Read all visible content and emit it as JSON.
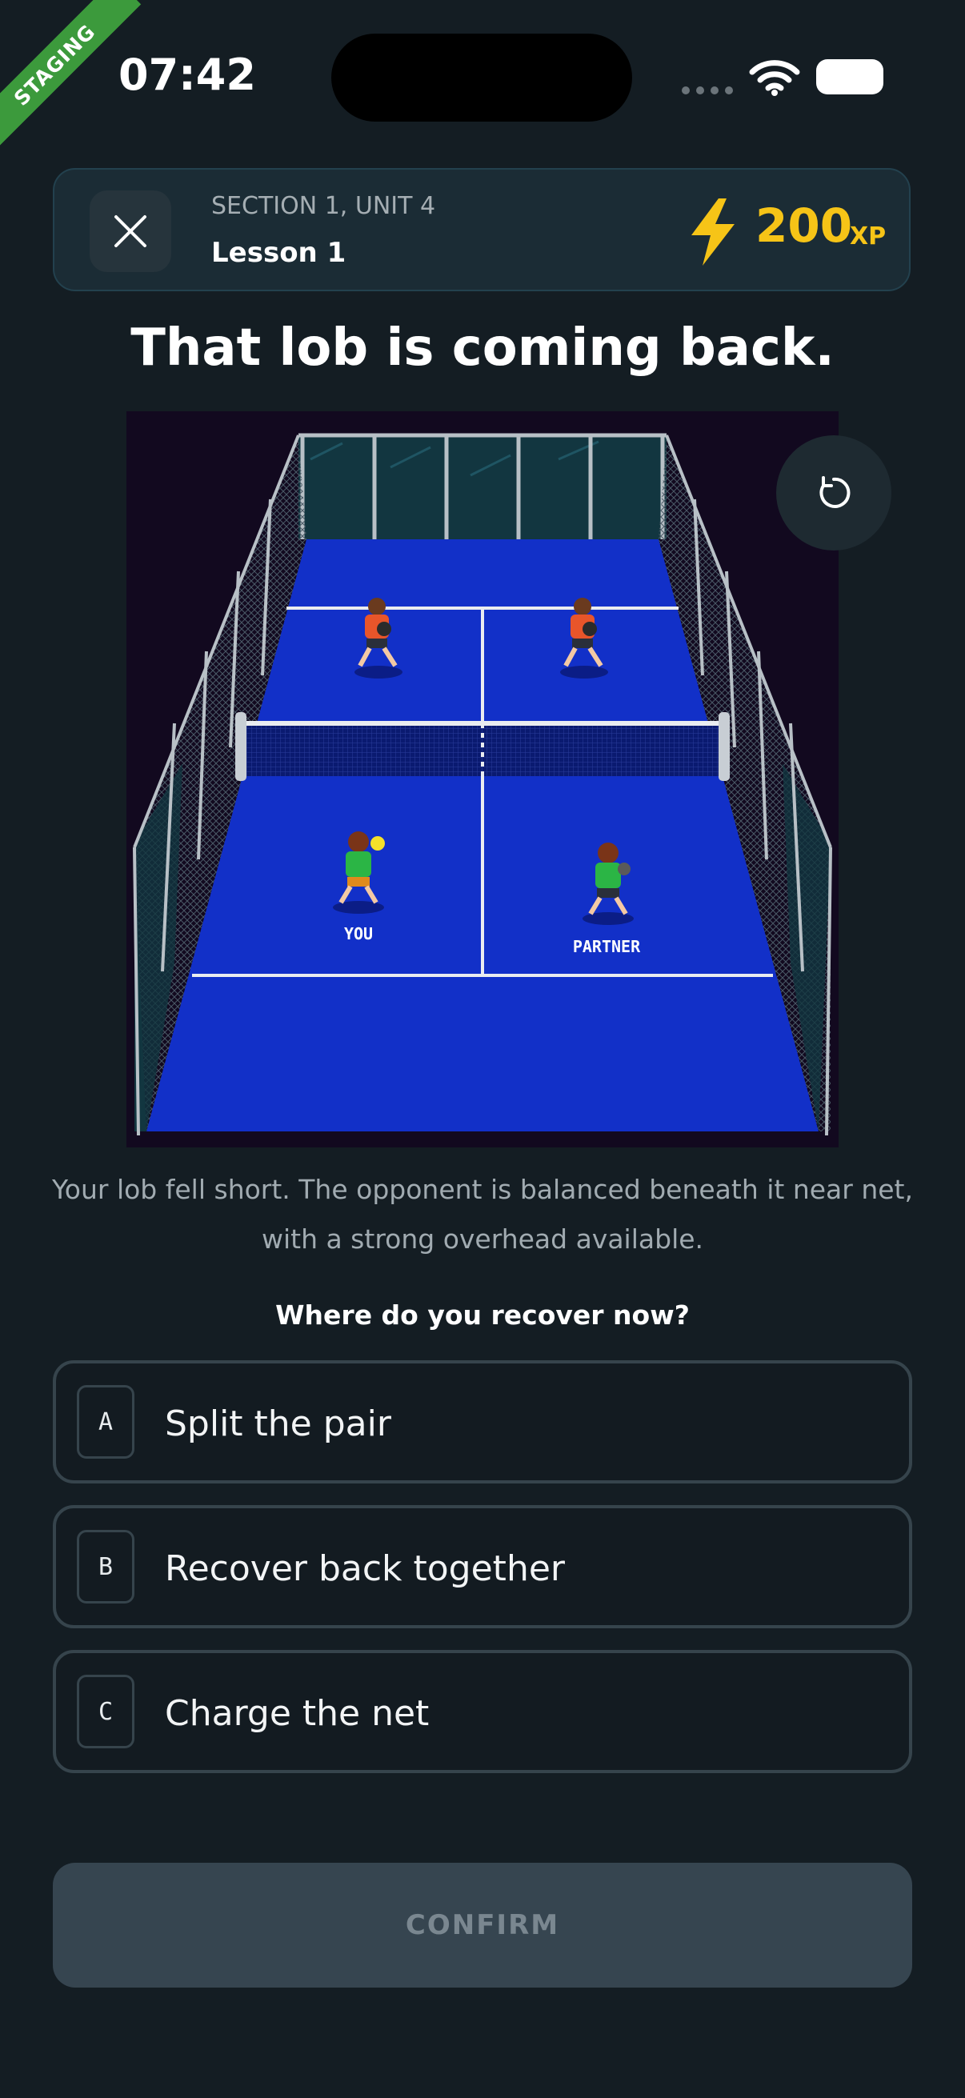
{
  "status_bar": {
    "environment_badge": "STAGING",
    "time": "07:42"
  },
  "header": {
    "section": "SECTION 1, UNIT 4",
    "lesson": "Lesson 1",
    "xp_value": "200",
    "xp_unit": "XP",
    "xp_color": "#f6c417"
  },
  "prompt": {
    "title": "That lob is coming back.",
    "description": "Your lob fell short. The opponent is balanced beneath it near net, with a strong overhead available.",
    "question": "Where do you recover now?"
  },
  "court": {
    "you_label": "YOU",
    "partner_label": "PARTNER",
    "court_color": "#1230c8",
    "opponent_shirt_color": "#e8552a",
    "team_shirt_color": "#2bb545"
  },
  "options": [
    {
      "key": "A",
      "label": "Split the pair"
    },
    {
      "key": "B",
      "label": "Recover back together"
    },
    {
      "key": "C",
      "label": "Charge the net"
    }
  ],
  "confirm_label": "CONFIRM",
  "icons": {
    "close": "close-icon",
    "xp": "lightning-bolt-icon",
    "replay": "replay-icon",
    "wifi": "wifi-icon",
    "battery": "battery-icon"
  }
}
